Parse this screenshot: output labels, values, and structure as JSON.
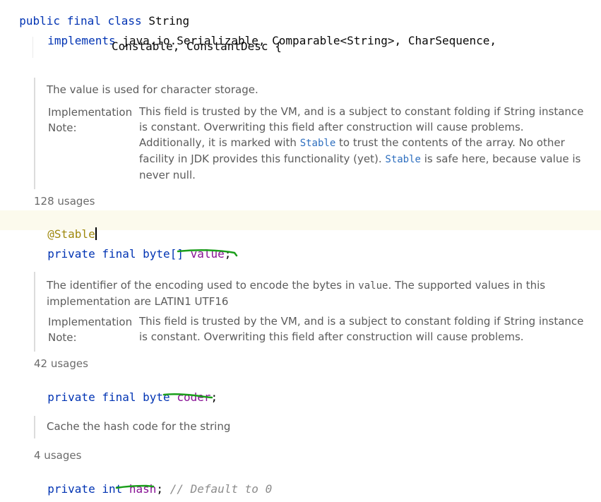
{
  "editor": {
    "decl": {
      "public": "public",
      "final": "final",
      "class": "class",
      "name": "String",
      "implements": "implements",
      "interfaces_line1": "java.io.Serializable, Comparable<String>, CharSequence,",
      "interfaces_line2": "Constable, ConstantDesc {"
    },
    "doc1": {
      "summary": "The value is used for character storage.",
      "label_line1": "Implementation",
      "label_line2": "Note:",
      "body_part1": "This field is trusted by the VM, and is a subject to constant folding if String instance is constant. Overwriting this field after construction will cause problems. Additionally, it is marked with ",
      "link1": "Stable",
      "body_part2": " to trust the contents of the array. No other facility in JDK provides this functionality (yet). ",
      "link2": "Stable",
      "body_part3": " is safe here, because value is never null."
    },
    "usages1": "128 usages",
    "annotation": "@Stable",
    "field1": {
      "private": "private",
      "final": "final",
      "type": "byte[]",
      "name": "value",
      "semi": ";"
    },
    "doc2": {
      "summary_part1": "The identifier of the encoding used to encode the bytes in ",
      "summary_code": "value",
      "summary_part2": ". The supported values in this implementation are LATIN1 UTF16",
      "label_line1": "Implementation",
      "label_line2": "Note:",
      "body": "This field is trusted by the VM, and is a subject to constant folding if String instance is constant. Overwriting this field after construction will cause problems."
    },
    "usages2": "42 usages",
    "field2": {
      "private": "private",
      "final": "final",
      "type": "byte",
      "name": "coder",
      "semi": ";"
    },
    "doc3": {
      "summary": "Cache the hash code for the string"
    },
    "usages3": "4 usages",
    "field3": {
      "private": "private",
      "type": "int",
      "name": "hash",
      "semi": ";",
      "comment": "// Default to 0"
    },
    "colors": {
      "keyword": "#0033b3",
      "field": "#871094",
      "annotation": "#9e880d",
      "comment": "#8c8c8c",
      "underline": "#1a9e1a",
      "caret_line": "#fcfaed"
    }
  }
}
